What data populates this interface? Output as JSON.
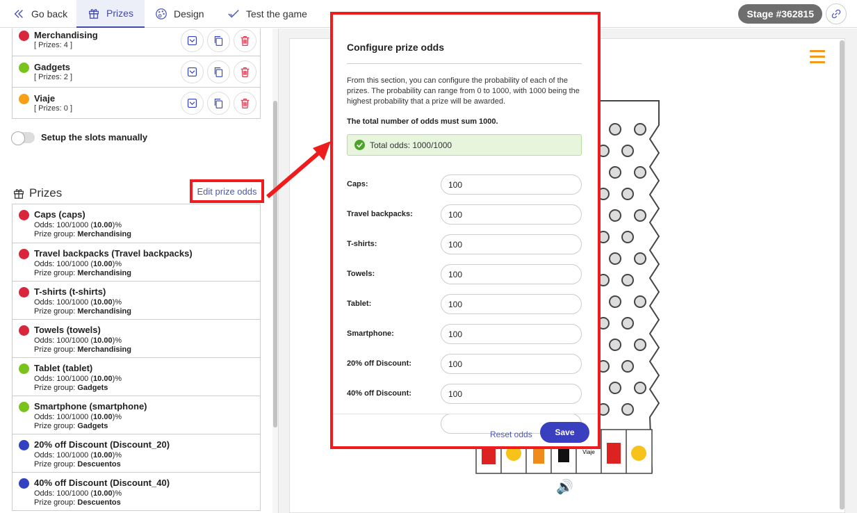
{
  "topbar": {
    "go_back": "Go back",
    "prizes_tab": "Prizes",
    "design_tab": "Design",
    "test_tab": "Test the game",
    "stage": "Stage #362815"
  },
  "groups": [
    {
      "name": "Merchandising",
      "count": "[ Prizes: 4 ]",
      "color": "#d9263b"
    },
    {
      "name": "Gadgets",
      "count": "[ Prizes: 2 ]",
      "color": "#79c31a"
    },
    {
      "name": "Viaje",
      "count": "[ Prizes: 0 ]",
      "color": "#f6a01a"
    }
  ],
  "slots_toggle_label": "Setup the slots manually",
  "prizes_section": {
    "title": "Prizes",
    "edit_odds": "Edit prize odds",
    "odds_prefix": "Odds:",
    "group_prefix": "Prize group:",
    "items": [
      {
        "name": "Caps (caps)",
        "odds": "100/1000",
        "percent": "10.00",
        "group": "Merchandising",
        "color": "#d9263b"
      },
      {
        "name": "Travel backpacks (Travel backpacks)",
        "odds": "100/1000",
        "percent": "10.00",
        "group": "Merchandising",
        "color": "#d9263b"
      },
      {
        "name": "T-shirts (t-shirts)",
        "odds": "100/1000",
        "percent": "10.00",
        "group": "Merchandising",
        "color": "#d9263b"
      },
      {
        "name": "Towels (towels)",
        "odds": "100/1000",
        "percent": "10.00",
        "group": "Merchandising",
        "color": "#d9263b"
      },
      {
        "name": "Tablet (tablet)",
        "odds": "100/1000",
        "percent": "10.00",
        "group": "Gadgets",
        "color": "#79c31a"
      },
      {
        "name": "Smartphone (smartphone)",
        "odds": "100/1000",
        "percent": "10.00",
        "group": "Gadgets",
        "color": "#79c31a"
      },
      {
        "name": "20% off Discount (Discount_20)",
        "odds": "100/1000",
        "percent": "10.00",
        "group": "Descuentos",
        "color": "#3340c0"
      },
      {
        "name": "40% off Discount (Discount_40)",
        "odds": "100/1000",
        "percent": "10.00",
        "group": "Descuentos",
        "color": "#3340c0"
      }
    ]
  },
  "modal": {
    "title": "Configure prize odds",
    "description": "From this section, you can configure the probability of each of the prizes. The probability can range from 0 to 1000, with 1000 being the highest probability that a prize will be awarded.",
    "total_rule": "The total number of odds must sum 1000.",
    "total_status": "Total odds: 1000/1000",
    "rows": [
      {
        "label": "Caps:",
        "value": "100"
      },
      {
        "label": "Travel backpacks:",
        "value": "100"
      },
      {
        "label": "T-shirts:",
        "value": "100"
      },
      {
        "label": "Towels:",
        "value": "100"
      },
      {
        "label": "Tablet:",
        "value": "100"
      },
      {
        "label": "Smartphone:",
        "value": "100"
      },
      {
        "label": "20% off Discount:",
        "value": "100"
      },
      {
        "label": "40% off Discount:",
        "value": "100"
      }
    ],
    "reset": "Reset odds",
    "save": "Save"
  },
  "preview": {
    "slot_label": "Viaje"
  },
  "colors": {
    "accent": "#3a3fc0",
    "highlight": "#ee1c1c",
    "brand_orange": "#f39a1e"
  }
}
